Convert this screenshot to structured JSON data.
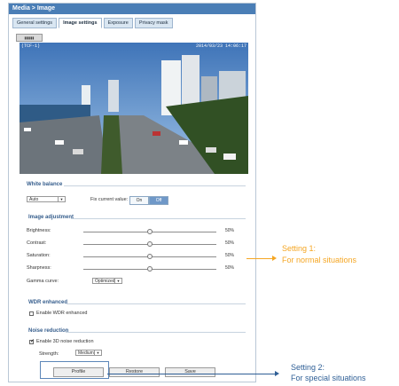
{
  "window": {
    "title": "Media > Image"
  },
  "tabs": [
    {
      "label": "General settings"
    },
    {
      "label": "Image settings"
    },
    {
      "label": "Exposure"
    },
    {
      "label": "Privacy mask"
    }
  ],
  "small_button": {
    "label": "▮▮▮▮▮"
  },
  "video": {
    "left_osd": "(TCF-1)",
    "right_osd": "2014/03/23 14:06:17"
  },
  "white_balance": {
    "title": "White balance",
    "mode": "Auto",
    "fix_label": "Fix current value:",
    "on": "On",
    "off": "Off"
  },
  "image_adjustment": {
    "title": "Image adjustment",
    "items": [
      {
        "label": "Brightness:",
        "value": "50%",
        "fraction": 0.5
      },
      {
        "label": "Contrast:",
        "value": "50%",
        "fraction": 0.5
      },
      {
        "label": "Saturation:",
        "value": "50%",
        "fraction": 0.5
      },
      {
        "label": "Sharpness:",
        "value": "50%",
        "fraction": 0.5
      }
    ],
    "gamma": {
      "label": "Gamma curve:",
      "value": "Optimized"
    }
  },
  "wdr": {
    "title": "WDR enhanced",
    "checkbox_label": "Enable WDR enhanced"
  },
  "noise": {
    "title": "Noise reduction",
    "checkbox_label": "Enable 3D noise reduction",
    "strength_label": "Strength:",
    "strength_value": "Medium"
  },
  "buttons": {
    "profile": "Profile",
    "restore": "Restore",
    "save": "Save"
  },
  "callouts": {
    "setting1_line1": "Setting 1:",
    "setting1_line2": "For normal situations",
    "setting2_line1": "Setting 2:",
    "setting2_line2": "For special situations"
  },
  "colors": {
    "header_blue": "#4a7eb6",
    "section_blue": "#355d8c",
    "orange": "#f5a623"
  }
}
